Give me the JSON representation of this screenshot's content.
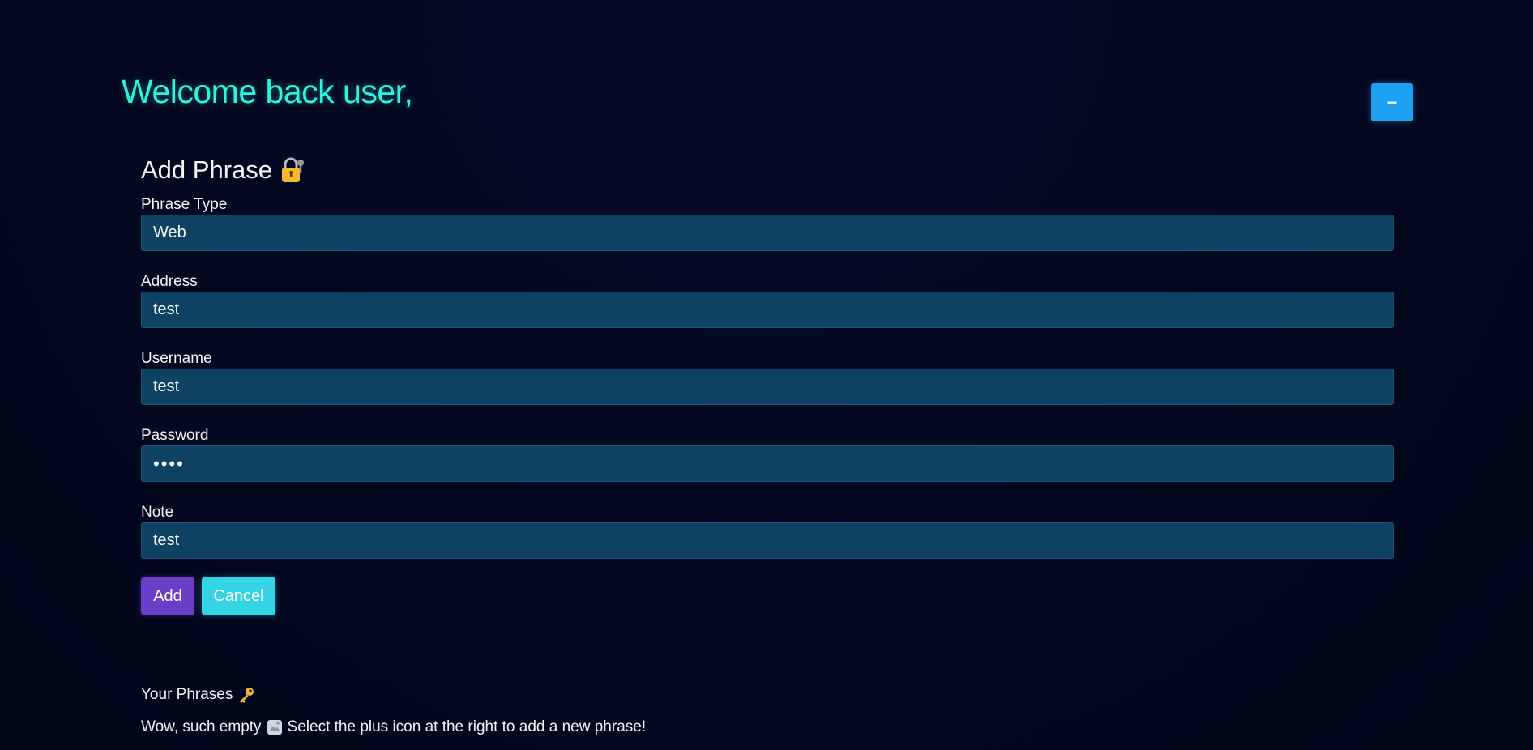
{
  "header": {
    "welcome_text": "Welcome back user,",
    "toggle_label": "−"
  },
  "form": {
    "title": "Add Phrase",
    "title_icon": "lock-key-icon",
    "fields": [
      {
        "label": "Phrase Type",
        "value": "Web"
      },
      {
        "label": "Address",
        "value": "test"
      },
      {
        "label": "Username",
        "value": "test"
      },
      {
        "label": "Password",
        "value": "••••"
      },
      {
        "label": "Note",
        "value": "test"
      }
    ],
    "add_label": "Add",
    "cancel_label": "Cancel"
  },
  "phrases": {
    "title": "Your Phrases",
    "title_icon": "key-icon",
    "empty_text_before": "Wow, such empty",
    "empty_icon": "mind-blown-icon",
    "empty_text_after": "Select the plus icon at the right to add a new phrase!"
  },
  "colors": {
    "background": "#03081f",
    "welcome": "#2ef5dd",
    "toggle_button": "#1da1f2",
    "input_bg": "#0e4262",
    "add_button": "#6a3fc8",
    "cancel_button": "#34d3e6"
  }
}
